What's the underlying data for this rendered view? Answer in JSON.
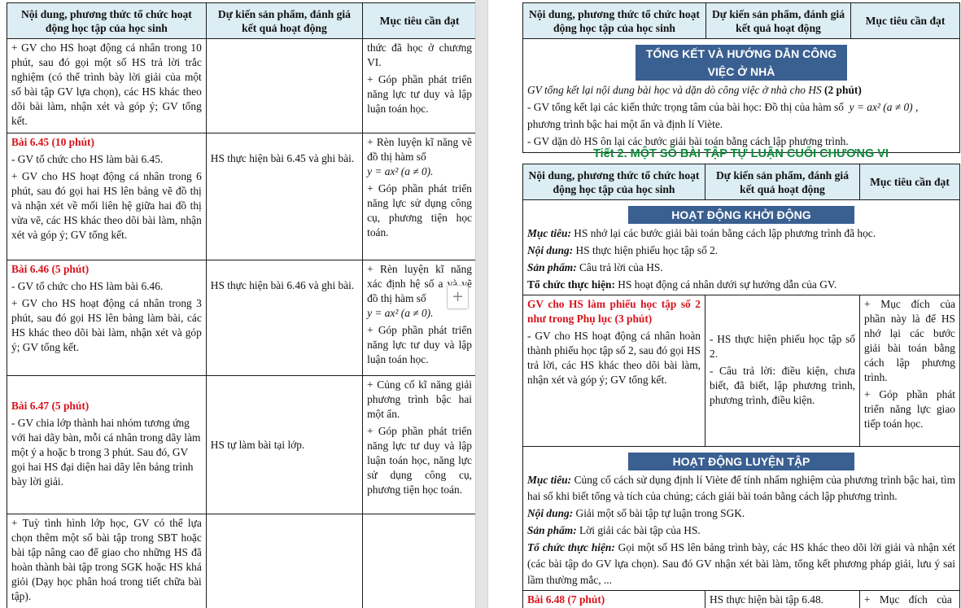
{
  "left_page": {
    "headers": [
      "Nội dung, phương thức tổ chức hoạt động học tập của học sinh",
      "Dự kiến sản phẩm, đánh giá kết quả hoạt động",
      "Mục tiêu cần đạt"
    ],
    "rows": [
      {
        "col1": [
          "+ GV cho HS hoạt động cá nhân trong 10 phút, sau đó gọi một số HS trả lời trắc nghiệm (có thể trình bày lời giải của một số bài tập GV lựa chọn), các HS khác theo dõi bài làm, nhận xét và góp ý; GV tổng kết."
        ],
        "col2": "",
        "col3": [
          "thức đã học ở chương VI.",
          "+ Góp phần phát triển năng lực tư duy và lập luận toán học."
        ]
      },
      {
        "title": "Bài 6.45 (10 phút)",
        "col1": [
          "- GV tổ chức cho HS làm bài 6.45.",
          "+ GV cho HS hoạt động cá nhân trong 6 phút, sau đó gọi hai HS lên bảng vẽ đồ thị và nhận xét về mối liên hệ giữa hai đồ thị vừa vẽ, các HS khác theo dõi bài làm, nhận xét và góp ý; GV tổng kết."
        ],
        "col2": "HS thực hiện bài 6.45 và ghi bài.",
        "col3_a": "+ Rèn luyện kĩ năng vẽ đồ thị hàm số",
        "col3_math": "y = ax² (a ≠ 0).",
        "col3_b": "+ Góp phần phát triển năng lực sử dụng công cụ, phương tiện học toán."
      },
      {
        "title": "Bài 6.46 (5 phút)",
        "col1": [
          "- GV tổ chức cho HS làm bài 6.46.",
          "+ GV cho HS hoạt động cá nhân trong 3 phút, sau đó gọi HS lên bảng làm bài, các HS khác theo dõi bài làm, nhận xét và góp ý; GV tổng kết."
        ],
        "col2": "HS thực hiện bài 6.46 và ghi bài.",
        "col3_a": "+ Rèn luyện kĩ năng xác định hệ số a và vẽ đồ thị hàm số",
        "col3_math": "y = ax² (a ≠ 0).",
        "col3_b": "+ Góp phần phát triển năng lực tư duy và lập luận toán học."
      },
      {
        "title": "Bài 6.47 (5 phút)",
        "col1": [
          "- GV chia lớp thành hai nhóm tương ứng với hai dãy bàn, mỗi cá nhân trong dãy làm một ý a hoặc b trong 3 phút. Sau đó, GV gọi hai HS đại diện hai dãy lên bảng trình bày lời giải."
        ],
        "col2": "HS tự làm bài tại lớp.",
        "col3": [
          "+ Củng cố kĩ năng giải phương trình bậc hai một ẩn.",
          "+ Góp phần phát triển năng lực tư duy và lập luận toán học, năng lực sử dụng công cụ, phương tiện học toán."
        ]
      },
      {
        "col1": [
          "+ Tuỳ tình hình lớp học, GV có thể lựa chọn thêm một số bài tập trong SBT hoặc bài tập nâng cao để giao cho những HS đã hoàn thành bài tập trong SGK hoặc HS khá giỏi (Dạy học phân hoá trong tiết chữa bài tập)."
        ],
        "col2": "",
        "col3": []
      }
    ]
  },
  "right_page": {
    "table1": {
      "headers": [
        "Nội dung, phương thức tổ chức hoạt động học tập của học sinh",
        "Dự kiến sản phẩm, đánh giá kết quả hoạt động",
        "Mục tiêu cần đạt"
      ],
      "banner": "TỔNG KẾT VÀ HƯỚNG DẪN CÔNG VIỆC Ở NHÀ",
      "intro_italic": "GV tổng kết lại nội dung bài học và dặn dò công việc ở nhà cho HS",
      "intro_bold": "(2 phút)",
      "line1_a": "- GV tổng kết lại các kiến thức trọng tâm của bài học: Đồ thị của hàm số",
      "line1_math": "y = ax² (a ≠ 0) ,",
      "line1_b": "phương trình bậc hai một ẩn và định lí Viète.",
      "line2": "- GV dặn dò HS ôn lại các bước giải bài toán bằng cách lập phương trình."
    },
    "section_title": "Tiết 2. MỘT SỐ BÀI TẬP TỰ LUẬN CUỐI CHƯƠNG VI",
    "table2": {
      "headers": [
        "Nội dung, phương thức tổ chức hoạt động học tập của học sinh",
        "Dự kiến sản phẩm, đánh giá kết quả hoạt động",
        "Mục tiêu cần đạt"
      ],
      "warmup": {
        "banner": "HOẠT ĐỘNG KHỞI ĐỘNG",
        "items": [
          {
            "label": "Mục tiêu:",
            "text": " HS nhớ lại các bước giải bài toán bằng cách lập phương trình đã học."
          },
          {
            "label": "Nội dung:",
            "text": " HS thực hiện phiếu học tập số 2."
          },
          {
            "label": "Sản phẩm:",
            "text": " Câu trả lời của HS."
          },
          {
            "label": "Tổ chức thực hiện:",
            "text": " HS hoạt động cá nhân dưới sự hướng dẫn của GV."
          }
        ],
        "row": {
          "title": "GV cho HS làm phiếu học tập số 2 như trong Phụ lục (3 phút)",
          "col1": "- GV cho HS hoạt động cá nhân hoàn thành phiếu học tập số 2, sau đó gọi HS trả lời, các HS khác theo dõi bài làm, nhận xét và góp ý; GV tổng kết.",
          "col2": [
            "- HS thực hiện phiếu học tập số 2.",
            "- Câu trả lời: điều kiện, chưa biết, đã biết, lập phương trình, phương trình, điều kiện."
          ],
          "col3": [
            "+ Mục đích của phần này là để HS nhớ lại các bước giải bài toán bằng cách lập phương trình.",
            "+ Góp phần phát triển năng lực giao tiếp toán học."
          ]
        }
      },
      "practice": {
        "banner": "HOẠT ĐỘNG LUYỆN TẬP",
        "items": [
          {
            "label": "Mục tiêu:",
            "text": " Củng cố cách sử dụng định lí Viète để tính nhẩm nghiệm của phương trình bậc hai, tìm hai số khi biết tổng và tích của chúng; cách giải bài toán bằng cách lập phương trình."
          },
          {
            "label": "Nội dung:",
            "text": " Giải một số bài tập tự luận trong SGK."
          },
          {
            "label": "Sản phẩm:",
            "text": " Lời giải các bài tập của HS."
          },
          {
            "label": "Tổ chức thực hiện:",
            "text": " Gọi một số HS lên bảng trình bày, các HS khác theo dõi lời giải và nhận xét (các bài tập do GV lựa chọn). Sau đó GV nhận xét bài làm, tổng kết phương pháp giải, lưu ý sai lầm thường mắc, ..."
          }
        ],
        "row": {
          "title": "Bài 6.48 (7 phút)",
          "col2": "HS thực hiện bài tập 6.48.",
          "col3": "+ Mục đích của"
        }
      }
    }
  },
  "toolbar": {
    "add_page_label": "+"
  }
}
